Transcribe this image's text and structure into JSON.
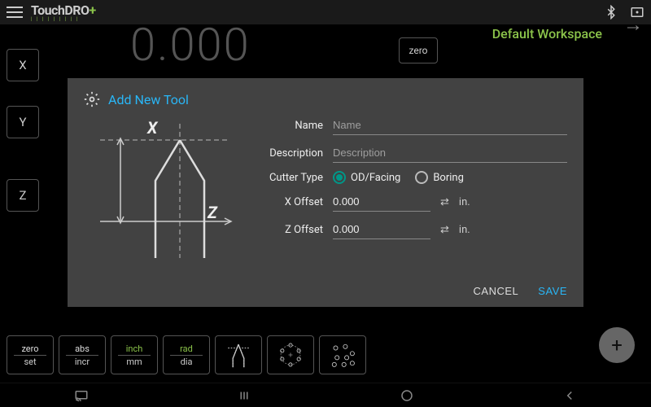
{
  "topbar": {
    "logo_main": "TouchDRO",
    "logo_plus": "+"
  },
  "workspace": {
    "title": "Default Workspace"
  },
  "readout": {
    "value": "0.000"
  },
  "axis": {
    "x": "X",
    "y": "Y",
    "z": "Z",
    "zero": "zero"
  },
  "bottombar": {
    "zero_set": {
      "l1": "zero",
      "l2": "set"
    },
    "abs_incr": {
      "l1": "abs",
      "l2": "incr"
    },
    "inch_mm": {
      "l1": "inch",
      "l2": "mm"
    },
    "rad_dia": {
      "l1": "rad",
      "l2": "dia"
    }
  },
  "dialog": {
    "title": "Add New Tool",
    "name_label": "Name",
    "name_placeholder": "Name",
    "desc_label": "Description",
    "desc_placeholder": "Description",
    "cutter_label": "Cutter Type",
    "radio_od": "OD/Facing",
    "radio_boring": "Boring",
    "xoffset_label": "X Offset",
    "xoffset_value": "0.000",
    "zoffset_label": "Z Offset",
    "zoffset_value": "0.000",
    "unit": "in.",
    "cancel": "CANCEL",
    "save": "SAVE",
    "diagram_x": "X",
    "diagram_z": "Z"
  },
  "fab": "+"
}
